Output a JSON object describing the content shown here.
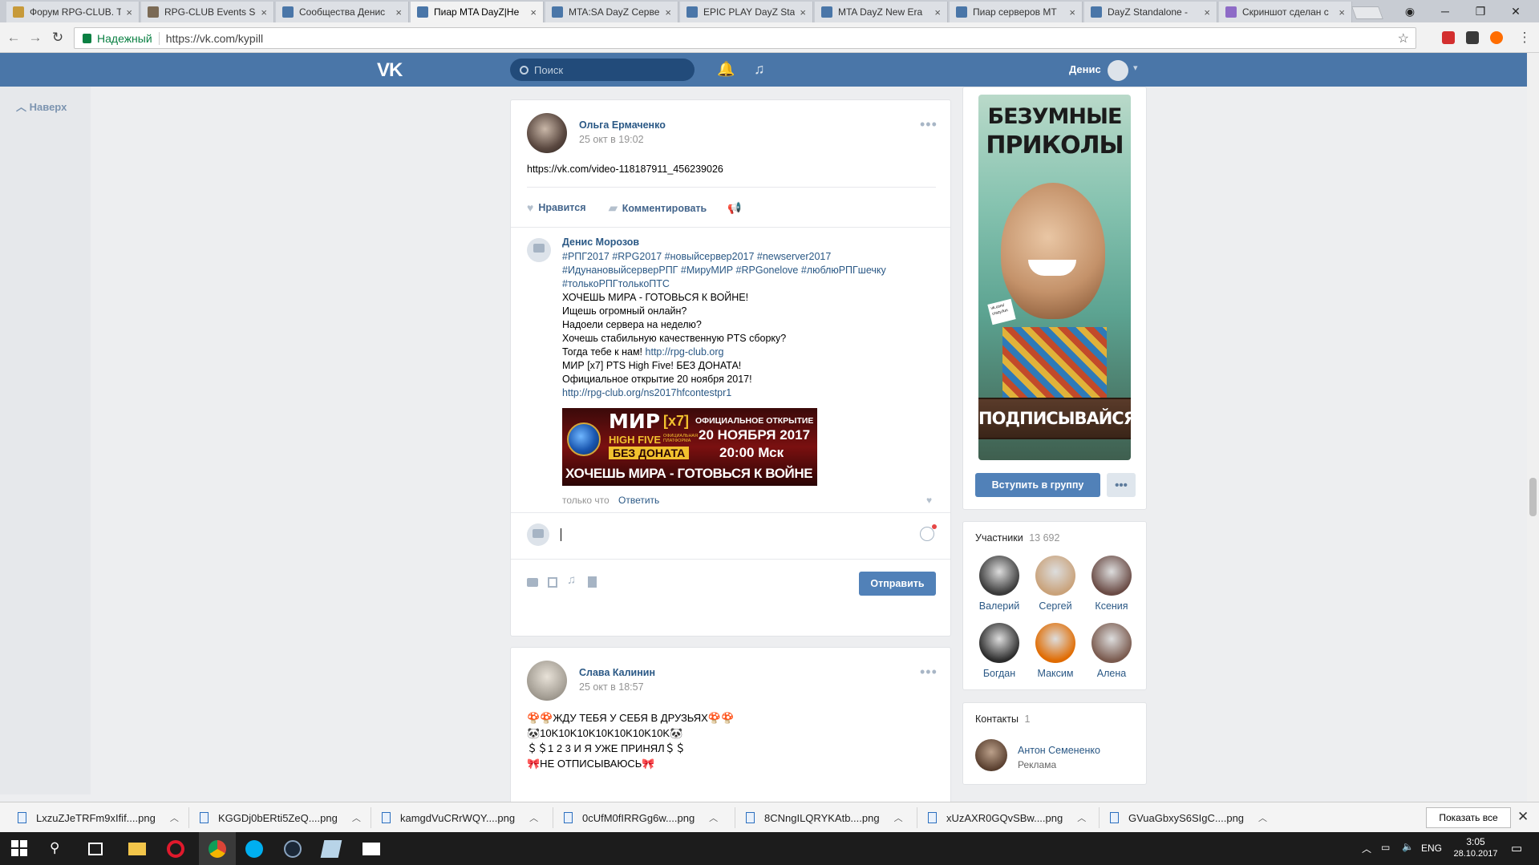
{
  "browser": {
    "tabs": [
      {
        "title": "Форум RPG-CLUB. T",
        "color": "#c79a3a"
      },
      {
        "title": "RPG-CLUB Events Sc",
        "color": "#7b6a55"
      },
      {
        "title": "Сообщества Денис",
        "color": "#4a76a8"
      },
      {
        "title": "Пиар MTA DayZ|Не",
        "color": "#4a76a8"
      },
      {
        "title": "MTA:SA DayZ Серве",
        "color": "#4a76a8"
      },
      {
        "title": "EPIC PLAY DayZ Sta",
        "color": "#4a76a8"
      },
      {
        "title": "MTA DayZ New Era",
        "color": "#4a76a8"
      },
      {
        "title": "Пиар серверов МТ",
        "color": "#4a76a8"
      },
      {
        "title": "DayZ Standalone - ",
        "color": "#4a76a8"
      },
      {
        "title": "Скриншот сделан с",
        "color": "#8e6bc7"
      }
    ],
    "close_glyph": "×",
    "secure_label": "Надежный",
    "url": "https://vk.com/kypill"
  },
  "vk": {
    "logo": "VK",
    "search_placeholder": "Поиск",
    "user_name": "Денис",
    "back_to_top": "Наверх"
  },
  "post1": {
    "author": "Ольга Ермаченко",
    "date": "25 окт в 19:02",
    "text": "https://vk.com/video-118187911_456239026",
    "like": "Нравится",
    "comment": "Комментировать"
  },
  "comment1": {
    "author": "Денис Морозов",
    "lines": [
      "#РПГ2017 #RPG2017 #новыйсервер2017 #newserver2017",
      "#ИдунановыйсерверРПГ #МируМИР #RPGonelove #люблюРПГшечку",
      "#толькоРПГтолькоПТС",
      "ХОЧЕШЬ МИРА - ГОТОВЬСЯ К ВОЙНЕ!",
      "Ищешь огромный онлайн?",
      "Надоели сервера на неделю?",
      "Хочешь стабильную качественную PTS сборку?"
    ],
    "line_link_prefix": "Тогда тебе к нам! ",
    "line_link": "http://rpg-club.org",
    "lines2": [
      "МИР [x7] PTS High Five! БЕЗ ДОНАТА!",
      "Официальное открытие 20 ноября 2017!"
    ],
    "link2": "http://rpg-club.org/ns2017hfcontestpr1",
    "time": "только что",
    "reply": "Ответить",
    "banner": {
      "title": "МИР",
      "rate": "[x7]",
      "subtitle": "HIGH FIVE",
      "small": "ОФИЦИАЛЬНАЯ ПЛАТФОРМА",
      "nodonate": "БЕЗ ДОНАТА",
      "open": "ОФИЦИАЛЬНОЕ ОТКРЫТИЕ",
      "date": "20 НОЯБРЯ 2017",
      "time": "20:00 Мск",
      "slogan": "ХОЧЕШЬ МИРА - ГОТОВЬСЯ К ВОЙНЕ"
    }
  },
  "composer": {
    "send": "Отправить"
  },
  "post2": {
    "author": "Слава Калинин",
    "date": "25 окт в 18:57",
    "lines": [
      "🍄🍄ЖДУ ТЕБЯ У СЕБЯ В ДРУЗЬЯХ🍄🍄",
      "🐼10K10K10K10K10K10K10K🐼",
      "＄＄1 2 3 И Я УЖЕ ПРИНЯЛ＄＄",
      "🎀НЕ ОТПИСЫВАЮСЬ🎀"
    ]
  },
  "group": {
    "banner_title_1": "БЕЗУМНЫЕ",
    "banner_title_2": "ПРИКОЛЫ",
    "banner_sign": "vk.com/ crazy.fun",
    "banner_bottom": "ПОДПИСЫВАЙСЯ",
    "join": "Вступить в группу",
    "members_label": "Участники",
    "members_count": "13 692",
    "members": [
      {
        "name": "Валерий",
        "color": "#3a3a3a"
      },
      {
        "name": "Сергей",
        "color": "#c9a27a"
      },
      {
        "name": "Ксения",
        "color": "#6a4b45"
      },
      {
        "name": "Богдан",
        "color": "#2b2b2b"
      },
      {
        "name": "Максим",
        "color": "#e06b00"
      },
      {
        "name": "Алена",
        "color": "#7a5a4e"
      }
    ],
    "contacts_label": "Контакты",
    "contacts_count": "1",
    "contact_name": "Антон Семененко",
    "contact_role": "Реклама"
  },
  "downloads": {
    "files": [
      "LxzuZJeTRFm9xIfif....png",
      "KGGDj0bERti5ZeQ....png",
      "kamgdVuCRrWQY....png",
      "0cUfM0fIRRGg6w....png",
      "8CNngILQRYKAtb....png",
      "xUzAXR0GQvSBw....png",
      "GVuaGbxyS6SIgC....png"
    ],
    "show_all": "Показать все"
  },
  "taskbar": {
    "lang": "ENG",
    "time": "3:05",
    "date": "28.10.2017"
  }
}
